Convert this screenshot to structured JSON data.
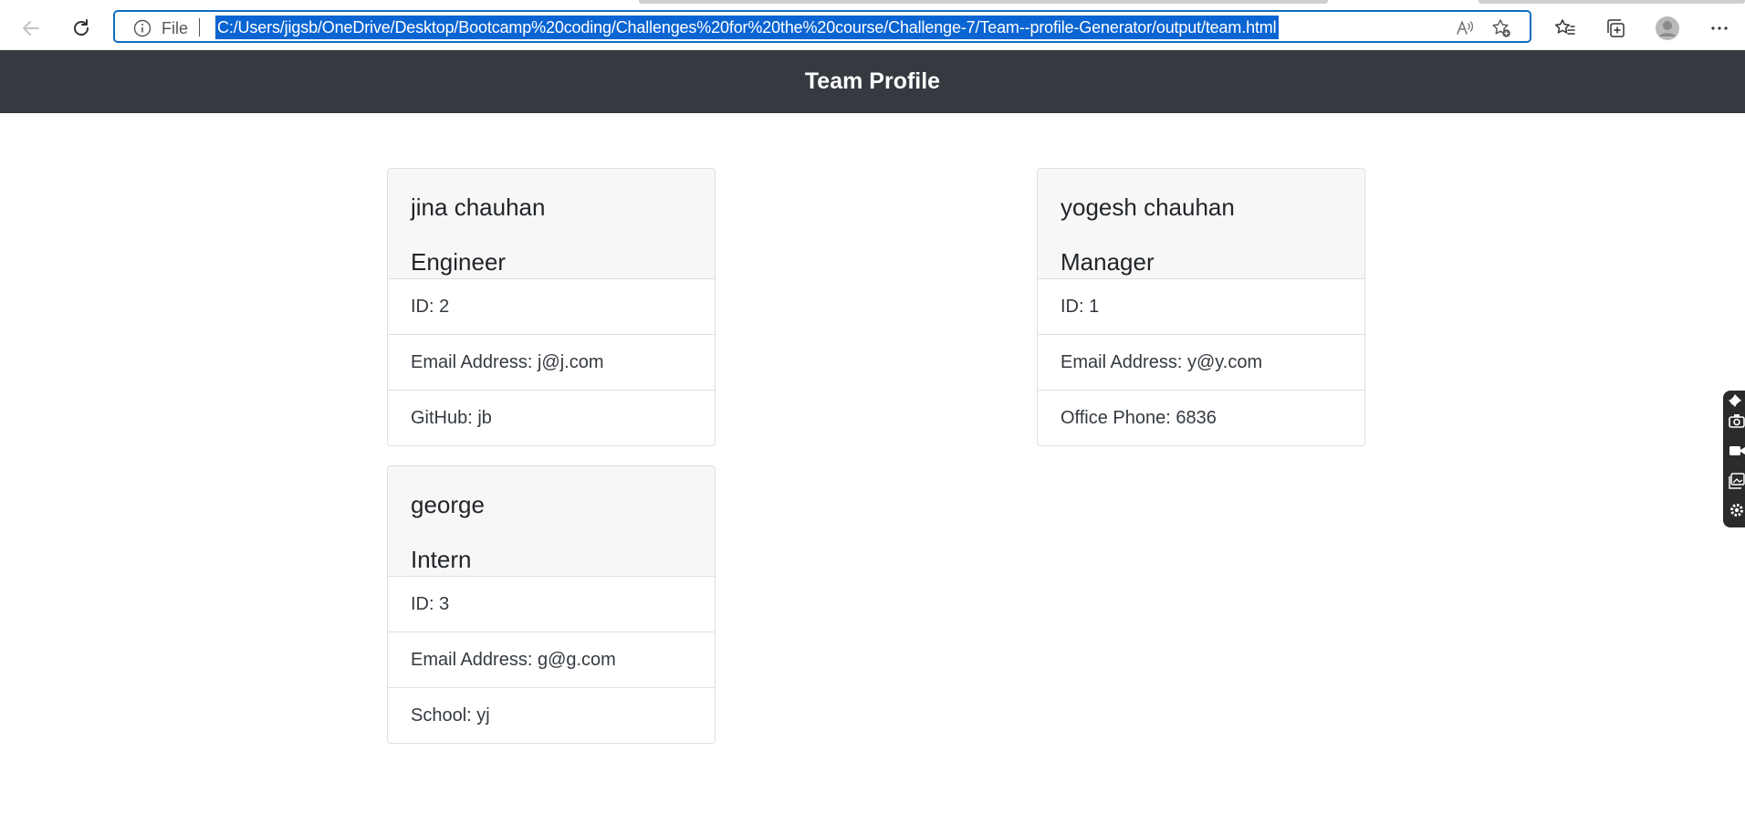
{
  "browser": {
    "address": {
      "scheme_label": "File",
      "url": "C:/Users/jigsb/OneDrive/Desktop/Bootcamp%20coding/Challenges%20for%20the%20course/Challenge-7/Team--profile-Generator/output/team.html"
    },
    "icons": [
      "back-icon",
      "refresh-icon",
      "info-icon",
      "read-aloud-icon",
      "add-favorite-icon",
      "favorites-icon",
      "collections-icon",
      "profile-icon",
      "more-icon"
    ]
  },
  "page": {
    "title": "Team Profile",
    "colors": {
      "navbar": "#343a40",
      "card_header": "#f7f7f7",
      "selection": "#0a64d2"
    },
    "cards": [
      {
        "name": "jina chauhan",
        "role": "Engineer",
        "items": [
          "ID: 2",
          "Email Address: j@j.com",
          "GitHub: jb"
        ]
      },
      {
        "name": "yogesh chauhan",
        "role": "Manager",
        "items": [
          "ID: 1",
          "Email Address: y@y.com",
          "Office Phone: 6836"
        ]
      },
      {
        "name": "george",
        "role": "Intern",
        "items": [
          "ID: 3",
          "Email Address: g@g.com",
          "School: yj"
        ]
      }
    ]
  }
}
